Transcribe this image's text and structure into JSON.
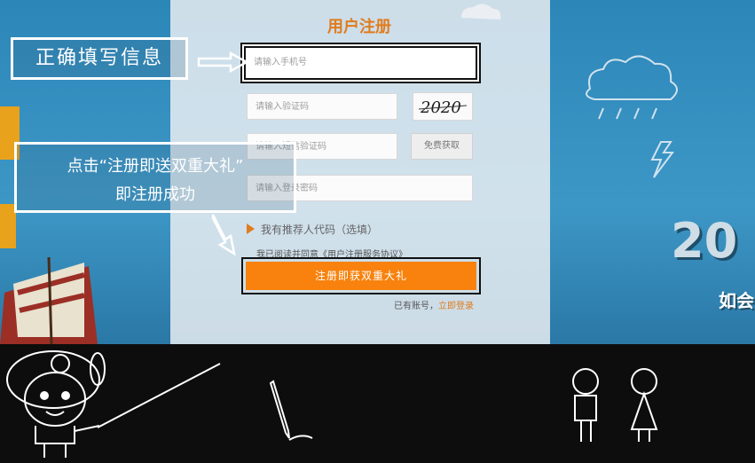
{
  "form": {
    "title": "用户注册",
    "phone_placeholder": "请输入手机号",
    "code_placeholder": "请输入验证码",
    "captcha_text": "2020",
    "sms_placeholder": "请输入短信验证码",
    "sms_button": "免费获取",
    "password_placeholder": "请输入登录密码",
    "referral": "我有推荐人代码（选填）",
    "agree": "我已阅读并同意《用户注册服务协议》",
    "register_button": "注册即获双重大礼",
    "login_prefix": "已有账号，",
    "login_link": "立即登录"
  },
  "tips": {
    "tip1": "正确填写信息",
    "tip2_line1": "点击“注册即送双重大礼”",
    "tip2_line2": "即注册成功"
  },
  "background": {
    "big_number": "20",
    "banner_text": "如会"
  },
  "colors": {
    "accent": "#f8820d",
    "title": "#e07c1d",
    "background_blue": "#2c86b8"
  }
}
